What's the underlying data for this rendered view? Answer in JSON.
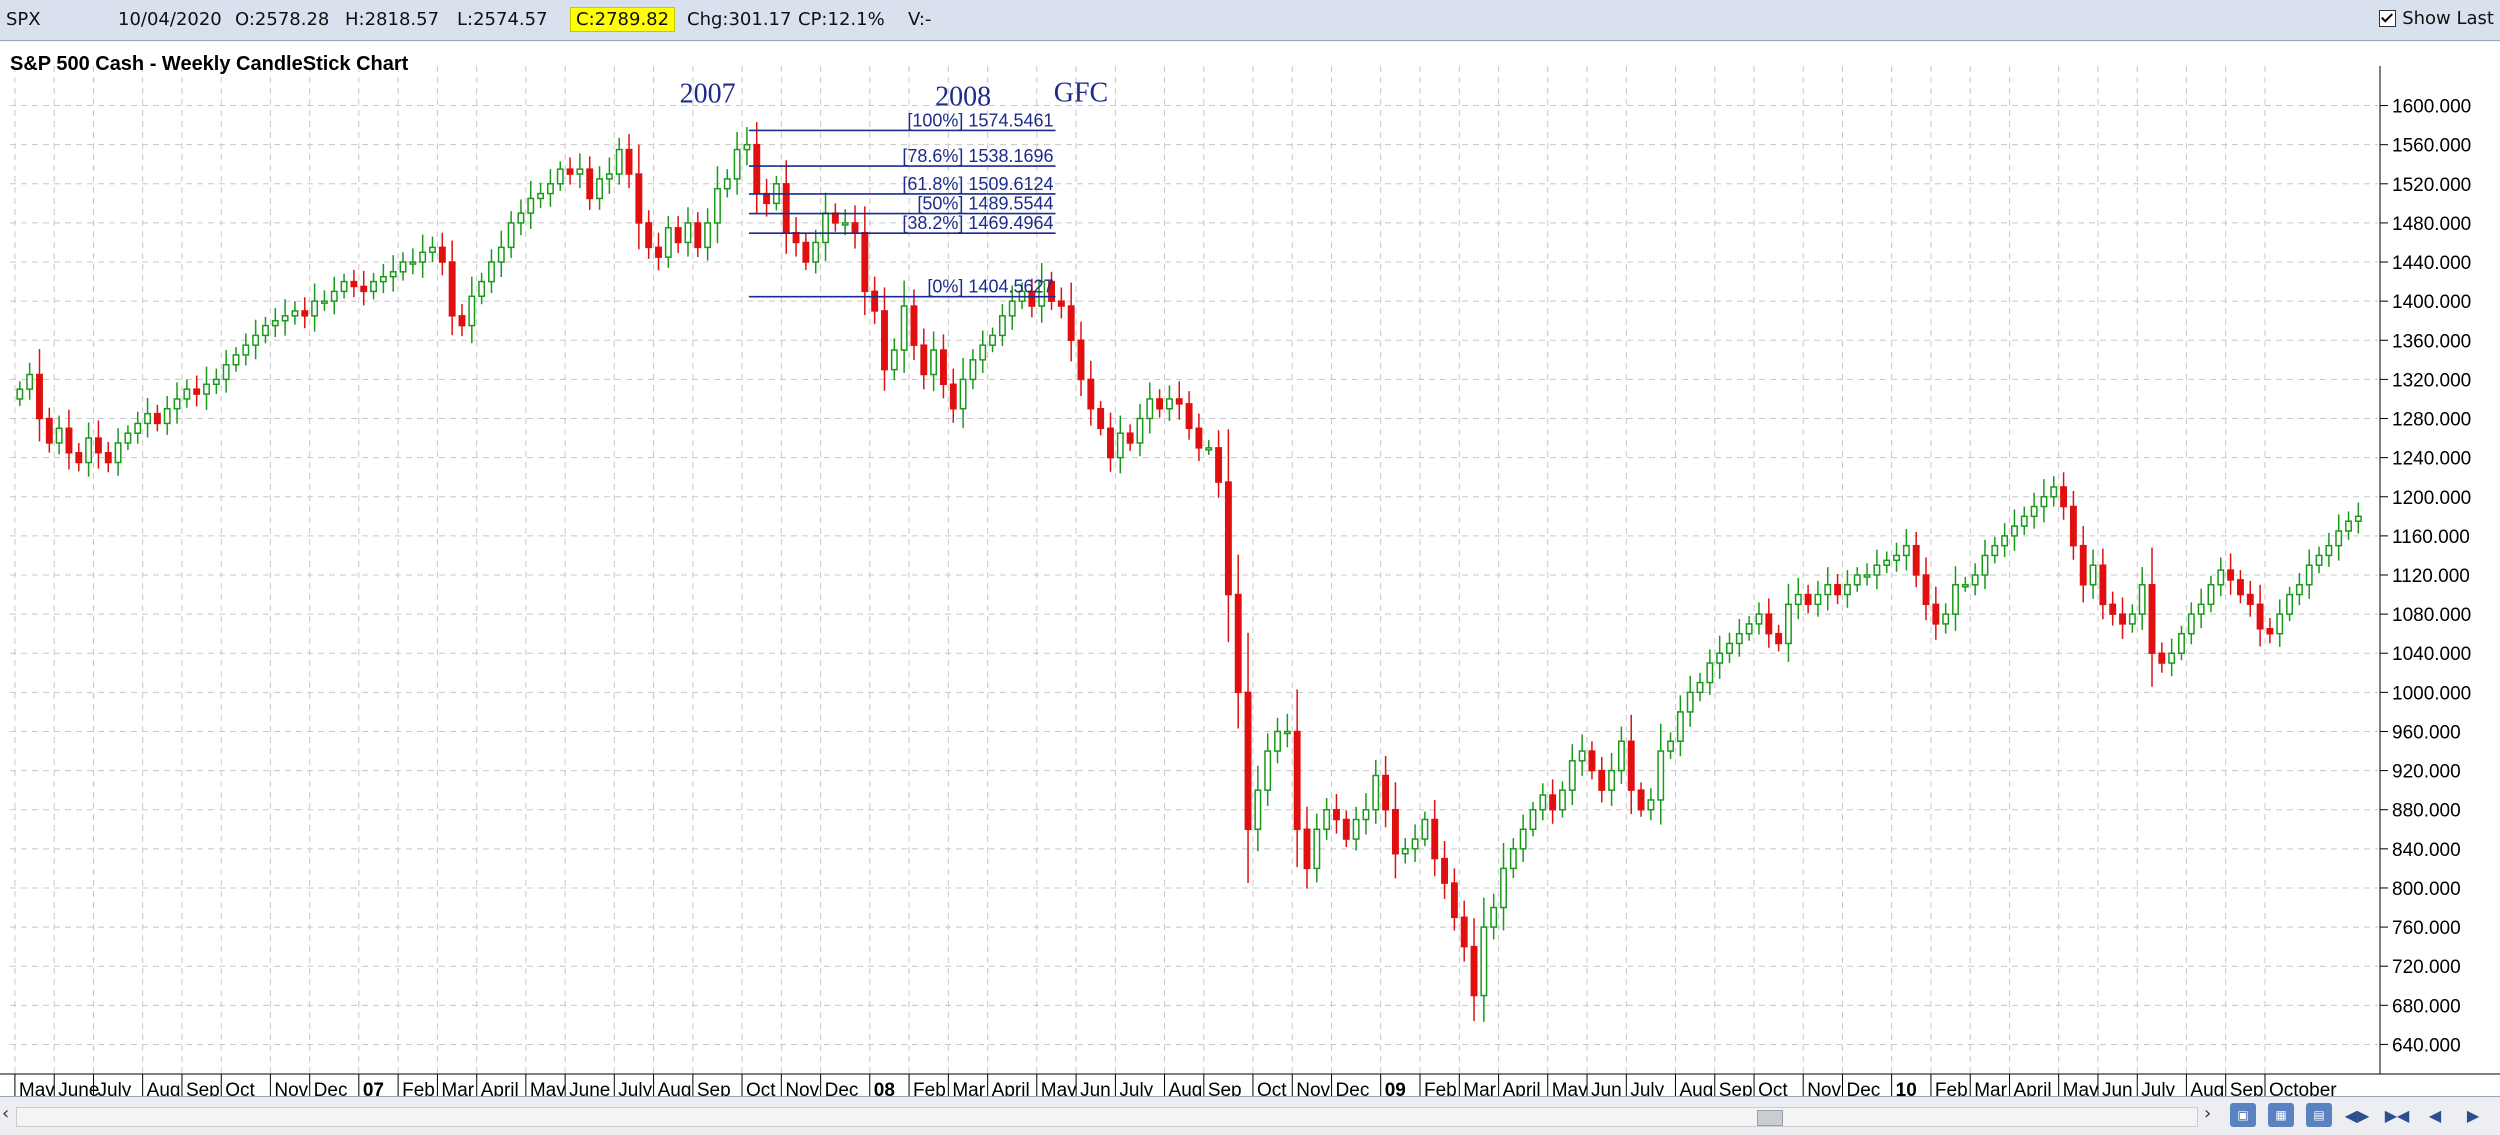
{
  "header": {
    "symbol": "SPX",
    "date": "10/04/2020",
    "open": "O:2578.28",
    "high": "H:2818.57",
    "low": "L:2574.57",
    "close": "C:2789.82",
    "change": "Chg:301.17",
    "change_pct": "CP:12.1%",
    "volume": "V:-",
    "show_last_label": "Show Last"
  },
  "colors": {
    "up": "#1a9a1a",
    "down": "#e01010",
    "annotation": "#1c2b8c",
    "fib_line": "#1c2b8c",
    "grid": "#c8c8c8",
    "highlight": "#ffff00"
  },
  "chart_data": {
    "type": "candlestick",
    "title": "S&P 500 Cash - Weekly CandleStick Chart",
    "timeframe": "weekly",
    "ylim": [
      620,
      1620
    ],
    "y_ticks": [
      "1600.000",
      "1560.000",
      "1520.000",
      "1480.000",
      "1440.000",
      "1400.000",
      "1360.000",
      "1320.000",
      "1280.000",
      "1240.000",
      "1200.000",
      "1160.000",
      "1120.000",
      "1080.000",
      "1040.000",
      "1000.000",
      "960.000",
      "920.000",
      "880.000",
      "840.000",
      "800.000",
      "760.000",
      "720.000",
      "680.000",
      "640.000"
    ],
    "x_ticks": [
      {
        "label": "May",
        "week": 0
      },
      {
        "label": "June",
        "week": 4
      },
      {
        "label": "July",
        "week": 8
      },
      {
        "label": "Aug",
        "week": 13
      },
      {
        "label": "Sep",
        "week": 17
      },
      {
        "label": "Oct",
        "week": 21
      },
      {
        "label": "Nov",
        "week": 26
      },
      {
        "label": "Dec",
        "week": 30
      },
      {
        "label": "07",
        "week": 35,
        "bold": true
      },
      {
        "label": "Feb",
        "week": 39
      },
      {
        "label": "Mar",
        "week": 43
      },
      {
        "label": "April",
        "week": 47
      },
      {
        "label": "May",
        "week": 52
      },
      {
        "label": "June",
        "week": 56
      },
      {
        "label": "July",
        "week": 61
      },
      {
        "label": "Aug",
        "week": 65
      },
      {
        "label": "Sep",
        "week": 69
      },
      {
        "label": "Oct",
        "week": 74
      },
      {
        "label": "Nov",
        "week": 78
      },
      {
        "label": "Dec",
        "week": 82
      },
      {
        "label": "08",
        "week": 87,
        "bold": true
      },
      {
        "label": "Feb",
        "week": 91
      },
      {
        "label": "Mar",
        "week": 95
      },
      {
        "label": "April",
        "week": 99
      },
      {
        "label": "May",
        "week": 104
      },
      {
        "label": "Jun",
        "week": 108
      },
      {
        "label": "July",
        "week": 112
      },
      {
        "label": "Aug",
        "week": 117
      },
      {
        "label": "Sep",
        "week": 121
      },
      {
        "label": "Oct",
        "week": 126
      },
      {
        "label": "Nov",
        "week": 130
      },
      {
        "label": "Dec",
        "week": 134
      },
      {
        "label": "09",
        "week": 139,
        "bold": true
      },
      {
        "label": "Feb",
        "week": 143
      },
      {
        "label": "Mar",
        "week": 147
      },
      {
        "label": "April",
        "week": 151
      },
      {
        "label": "May",
        "week": 156
      },
      {
        "label": "Jun",
        "week": 160
      },
      {
        "label": "July",
        "week": 164
      },
      {
        "label": "Aug",
        "week": 169
      },
      {
        "label": "Sep",
        "week": 173
      },
      {
        "label": "Oct",
        "week": 177
      },
      {
        "label": "Nov",
        "week": 182
      },
      {
        "label": "Dec",
        "week": 186
      },
      {
        "label": "10",
        "week": 191,
        "bold": true
      },
      {
        "label": "Feb",
        "week": 195
      },
      {
        "label": "Mar",
        "week": 199
      },
      {
        "label": "April",
        "week": 203
      },
      {
        "label": "May",
        "week": 208
      },
      {
        "label": "Jun",
        "week": 212
      },
      {
        "label": "July",
        "week": 216
      },
      {
        "label": "Aug",
        "week": 221
      },
      {
        "label": "Sep",
        "week": 225
      },
      {
        "label": "October",
        "week": 229
      }
    ],
    "closes": [
      1310,
      1325,
      1280,
      1255,
      1270,
      1245,
      1235,
      1260,
      1245,
      1235,
      1255,
      1265,
      1275,
      1285,
      1275,
      1290,
      1300,
      1310,
      1305,
      1315,
      1320,
      1335,
      1345,
      1355,
      1365,
      1375,
      1380,
      1385,
      1390,
      1385,
      1400,
      1400,
      1410,
      1420,
      1415,
      1410,
      1420,
      1425,
      1430,
      1440,
      1440,
      1450,
      1455,
      1440,
      1385,
      1375,
      1405,
      1420,
      1440,
      1455,
      1480,
      1490,
      1505,
      1510,
      1520,
      1535,
      1530,
      1535,
      1505,
      1525,
      1530,
      1555,
      1530,
      1480,
      1455,
      1445,
      1475,
      1460,
      1480,
      1455,
      1480,
      1515,
      1525,
      1555,
      1560,
      1510,
      1500,
      1520,
      1470,
      1460,
      1440,
      1460,
      1490,
      1480,
      1480,
      1470,
      1410,
      1390,
      1330,
      1350,
      1395,
      1355,
      1325,
      1350,
      1315,
      1290,
      1320,
      1340,
      1355,
      1365,
      1385,
      1400,
      1410,
      1395,
      1420,
      1400,
      1395,
      1360,
      1320,
      1290,
      1270,
      1240,
      1265,
      1255,
      1280,
      1300,
      1290,
      1300,
      1295,
      1270,
      1250,
      1250,
      1215,
      1100,
      1000,
      860,
      900,
      940,
      960,
      960,
      860,
      820,
      860,
      880,
      870,
      850,
      870,
      880,
      915,
      880,
      835,
      840,
      850,
      870,
      830,
      805,
      770,
      740,
      690,
      760,
      780,
      820,
      840,
      860,
      880,
      895,
      880,
      900,
      930,
      940,
      920,
      900,
      920,
      950,
      900,
      880,
      890,
      940,
      950,
      980,
      1000,
      1010,
      1030,
      1040,
      1050,
      1060,
      1070,
      1080,
      1060,
      1050,
      1090,
      1100,
      1090,
      1100,
      1110,
      1100,
      1110,
      1120,
      1120,
      1130,
      1135,
      1140,
      1150,
      1120,
      1090,
      1070,
      1080,
      1110,
      1110,
      1120,
      1140,
      1150,
      1160,
      1170,
      1180,
      1190,
      1200,
      1210,
      1190,
      1150,
      1110,
      1130,
      1090,
      1080,
      1070,
      1080,
      1110,
      1040,
      1030,
      1040,
      1060,
      1080,
      1090,
      1110,
      1125,
      1115,
      1100,
      1090,
      1065,
      1060,
      1080,
      1100,
      1110,
      1130,
      1140,
      1150,
      1165,
      1175,
      1180
    ],
    "fibonacci": [
      {
        "label": "[100%] 1574.5461",
        "value": 1574.5461
      },
      {
        "label": "[78.6%] 1538.1696",
        "value": 1538.1696
      },
      {
        "label": "[61.8%] 1509.6124",
        "value": 1509.6124
      },
      {
        "label": "[50%] 1489.5544",
        "value": 1489.5544
      },
      {
        "label": "[38.2%] 1469.4964",
        "value": 1469.4964
      },
      {
        "label": "[0%] 1404.5627",
        "value": 1404.5627
      }
    ],
    "fib_range_weeks": [
      74,
      105
    ],
    "annotations": [
      {
        "text": "2007",
        "week": 70,
        "value": 1603
      },
      {
        "text": "2008",
        "week": 96,
        "value": 1600
      },
      {
        "text": "GFC",
        "week": 108,
        "value": 1604
      }
    ]
  }
}
